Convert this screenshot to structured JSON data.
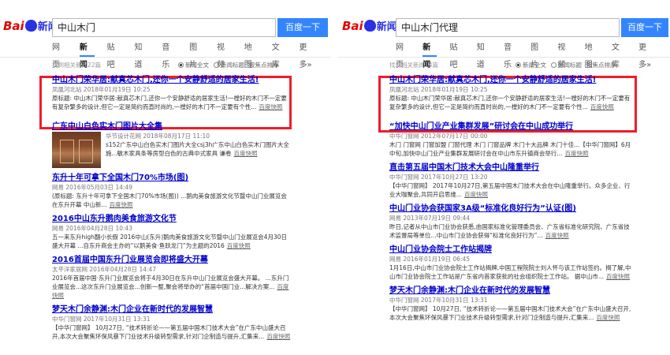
{
  "left": {
    "logo": {
      "bai": "Bai",
      "news": "新闻"
    },
    "search": {
      "value": "中山木门",
      "button": "百度一下"
    },
    "tabs": [
      "网页",
      "新闻",
      "贴吧",
      "知道",
      "音乐",
      "图片",
      "视频",
      "地图",
      "文库",
      "更多»"
    ],
    "active_tab": "新闻",
    "count": "找到相关新闻22篇",
    "opt_all": "新闻全文",
    "opt_title": "新闻标题",
    "sort": "按焦点排序",
    "results": [
      {
        "title": "中山木门荣华居:献真芯木门,还你一个安静舒适的居家生活!",
        "meta": "凤凰河北站   2018年01月19日  10:25",
        "snippet": "原标题: 中山木门荣华居:献真芯木门,还你一个安静舒适的居家生活!一樘好的木门不一定要有复杂繁多的设计,但它一定是简约而直时尚的,一樘好的木门不一定要有个性...",
        "snap": "百度快照"
      },
      {
        "title": "广东中山白色实木门图片大全集",
        "meta": "华节设计花网   2018年08月17日  11:10",
        "snippet": "s152广东中山白色实木门图片大全csj3h广东中山白色实木门图片大全 施...敏木家具条等房型白色的古典中式家具 谦卷",
        "snap": "百度快照"
      },
      {
        "title": "东升十年可拿下全国木门70%市场(图)",
        "meta": "网易   2016年05月03日  14:49",
        "snippet": "(原标题: 东升十年可拿下全国木门70%市场(图)) ...鹅肉美食旅游文化节暨中山门业展览会在东升开幕 中山新...",
        "snap": "百度快照"
      },
      {
        "title": "2016中山东升鹅肉美食旅游文化节",
        "meta": "网易   2016年04月28日  10:43",
        "snippet": "五一来东升high翻小长假 2016中山(东升)鹅肉美食旅游文化节暨中山门业展览会4月30日盛大开幕 ...自东升商会主办的“以鹅美食·鱼跃龙门”为主题的2016",
        "snap": "百度快照"
      },
      {
        "title": "2016首届中国东升门业展览会即将盛大开幕",
        "meta": "太平洋家居网   2016年04月28日  14:47",
        "snippet": "2016年首届中国·东升门业展览会将于4月30日在东升中山门业展览会盛大开幕。 ...东升门业展览会...这次东升门业展览会...创新一整,聚会将举办的“首届中国门业...解决方案...",
        "snap": "百度快照"
      },
      {
        "title": "梦天木门余静渊:木门企业在新时代的发展智慧",
        "meta": "中华门窗网   2017年10月31日  13:31",
        "snippet": "【中华门窗网】 10月27日, “技术转折论——第五届中国木门技术大会”在广东中山盛大召开,本次大会聚焦环保风暴下门业技术升级转型需求,针对门企制造与提升,汇集来...",
        "snap": "百度快照"
      }
    ]
  },
  "right": {
    "logo": {
      "bai": "Bai",
      "news": "新闻"
    },
    "search": {
      "value": "中山木门代理",
      "button": "百度一下"
    },
    "tabs": [
      "网页",
      "新闻",
      "贴吧",
      "知道",
      "音乐",
      "图片",
      "视频",
      "地图",
      "文库",
      "更多»"
    ],
    "active_tab": "新闻",
    "count": "找到相关新闻14篇",
    "opt_all": "新闻全文",
    "opt_title": "新闻标题",
    "sort": "按焦点排序",
    "results": [
      {
        "title": "中山木门荣华居:献真芯木门,还你一个安静舒适的居家生活!",
        "meta": "凤凰河北站   2018年01月19日  10:25",
        "snippet": "原标题: 中山木门荣华居:献真芯木门,还你一个安静舒适的居家生活!一樘好的木门不一定要有复杂繁多的设计,但它一定是简约而直时尚的,一樘好的木门不一定要有个性...",
        "snap": "百度快照"
      },
      {
        "title": "“加快中山门业产业集群发展”研讨会在中山成功举行",
        "meta": "中华门窗网   2012年07月17日  00:00",
        "snippet": "木门 门窗网 门窗加盟 门窗代理 木门 门窗品牌 木门十大品牌 木门十佳...【中华门窗网】6月中旬,加快中山门业产业集群发展研讨会在中山市东升镇商会举行...",
        "snap": "百度快照"
      },
      {
        "title": "直击第五届中国木门技术大会中山隆重举行",
        "meta": "中华门窗网   2017年10月27日  13:20",
        "snippet": "【中华门窗网】 2017年10月27日,第五届中国木门技术大会在中山隆重举行。众多企业、行业大咖聚会,共同开启思维...",
        "snap": "百度快照"
      },
      {
        "title": "中山门业协会获国家3A级“标准化良好行为”认证(图)",
        "meta": "网易   2013年07月19日  09:44",
        "snippet": "昨日,记者从中山市门业协会获悉,由国家标准化管理委员会、广东省标准化研究院、广东省技术监督局等单位...中山市门业协会获得“标准化良好行为”...",
        "snap": "百度快照"
      },
      {
        "title": "中山门业协会院士工作站揭牌",
        "meta": "网易   2016年01月19日  06:45",
        "snippet": "1月16日,中山市门业协会院士工作站揭牌,中国工程院院士刘人怀与该工作站签约。揭了解,中山市门业协会院士工作站是广东省内首家获批的社会组织院士工作站。 据中山市...",
        "snap": "百度快照"
      },
      {
        "title": "梦天木门余静渊:木门企业在新时代的发展智慧",
        "meta": "中华门窗网   2017年10月31日  13:31",
        "snippet": "【中华门窗网】 10月27日, “技术转折论——第五届中国木门技术大会”在广东中山盛大召开,本次大会聚焦环保风暴下门业技术升级转型需求,针对门企制造与提升,汇集来...",
        "snap": "百度快照"
      }
    ]
  }
}
